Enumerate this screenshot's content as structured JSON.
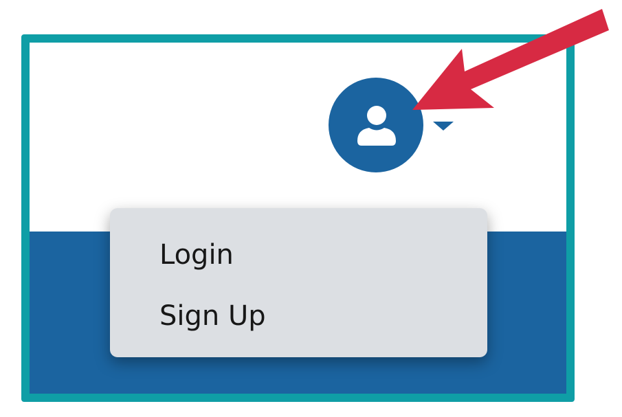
{
  "user_menu": {
    "avatar_icon": "user-icon",
    "caret_icon": "caret-down-icon",
    "items": [
      {
        "label": "Login"
      },
      {
        "label": "Sign Up"
      }
    ]
  },
  "colors": {
    "frame_border": "#0f9ea6",
    "brand_blue": "#1b64a0",
    "menu_background": "#dcdfe3",
    "menu_text": "#171717",
    "annotation_arrow": "#d72a43"
  }
}
